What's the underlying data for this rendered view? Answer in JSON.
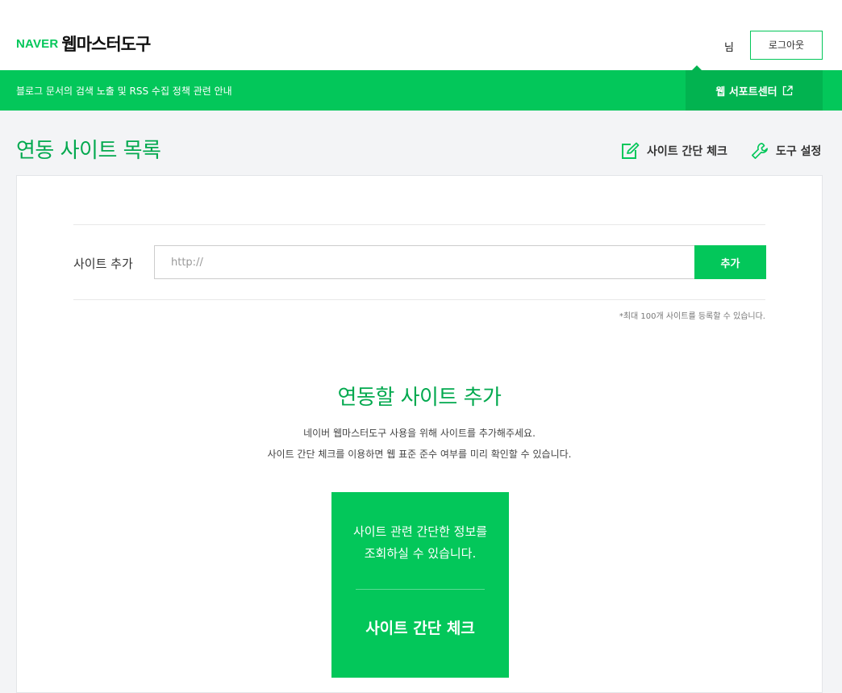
{
  "header": {
    "logo_brand": "NAVER",
    "logo_title": "웹마스터도구",
    "user_name": "님",
    "logout_label": "로그아웃"
  },
  "banner": {
    "notice": "블로그 문서의 검색 노출 및 RSS 수집 정책 관련 안내",
    "support_label": "웹 서포트센터"
  },
  "page": {
    "title": "연동 사이트 목록",
    "actions": [
      {
        "label": "사이트 간단 체크",
        "icon": "edit-check-icon"
      },
      {
        "label": "도구 설정",
        "icon": "wrench-icon"
      }
    ]
  },
  "add_site": {
    "label": "사이트 추가",
    "placeholder": "http://",
    "value": "",
    "button_label": "추가",
    "limit_note": "*최대 100개 사이트를 등록할 수 있습니다."
  },
  "empty_state": {
    "title": "연동할 사이트 추가",
    "lines": [
      "네이버 웹마스터도구 사용을 위해 사이트를 추가해주세요.",
      "사이트 간단 체크를 이용하면 웹 표준 준수 여부를 미리 확인할 수 있습니다."
    ],
    "card_lines": [
      "사이트 관련 간단한 정보를",
      "조회하실 수 있습니다."
    ],
    "card_button": "사이트 간단 체크"
  },
  "colors": {
    "brand": "#03c75a",
    "brand_dark": "#02b350",
    "title_green": "#03a94f"
  }
}
